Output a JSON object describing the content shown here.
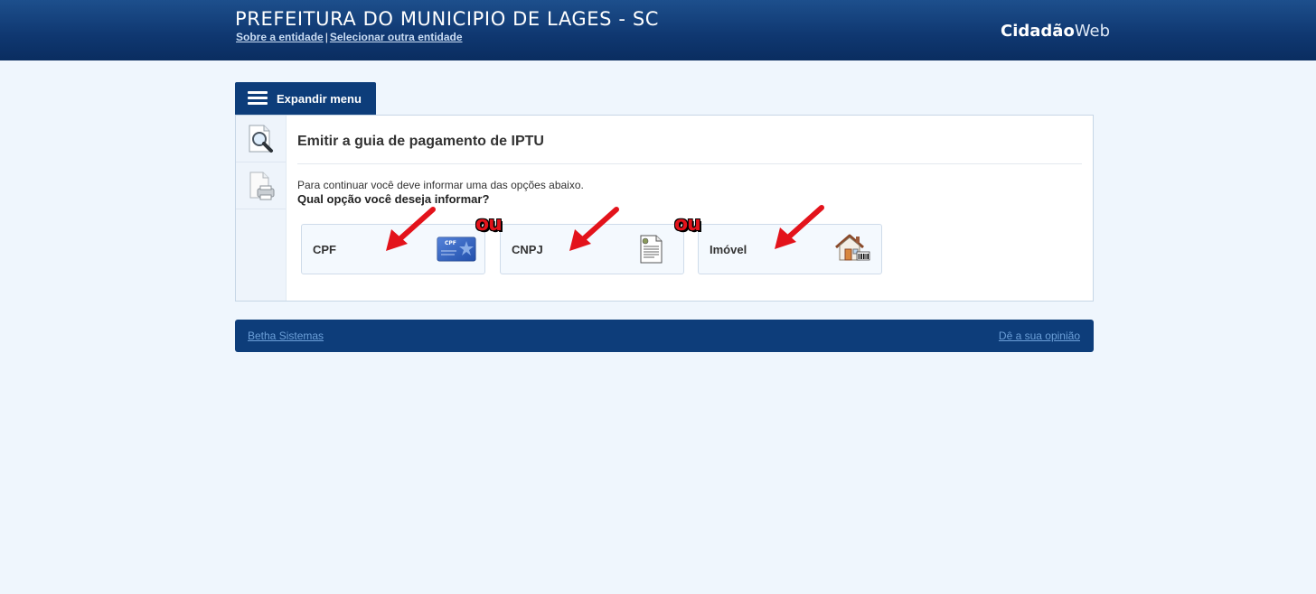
{
  "header": {
    "entity_title": "PREFEITURA DO MUNICIPIO DE LAGES - SC",
    "link_about": "Sobre a entidade",
    "link_separator": "|",
    "link_select": "Selecionar outra entidade",
    "brand_bold": "Cidadão",
    "brand_light": "Web"
  },
  "menu": {
    "expand_label": "Expandir menu",
    "side_items": [
      {
        "icon": "search-document-icon"
      },
      {
        "icon": "print-document-icon"
      }
    ]
  },
  "main": {
    "title": "Emitir a guia de pagamento de IPTU",
    "instruction": "Para continuar você deve informar uma das opções abaixo.",
    "question": "Qual opção você deseja informar?",
    "options": [
      {
        "label": "CPF",
        "icon": "id-card-icon"
      },
      {
        "label": "CNPJ",
        "icon": "document-icon"
      },
      {
        "label": "Imóvel",
        "icon": "house-icon"
      }
    ],
    "or_label": "ou",
    "card_text": "CPF"
  },
  "footer": {
    "left_link": "Betha Sistemas",
    "right_link": "Dê a sua opinião"
  },
  "colors": {
    "header_bg": "#0f3770",
    "tab_bg": "#0d3d7a",
    "page_bg": "#eff6fd",
    "arrow": "#e3131b"
  }
}
